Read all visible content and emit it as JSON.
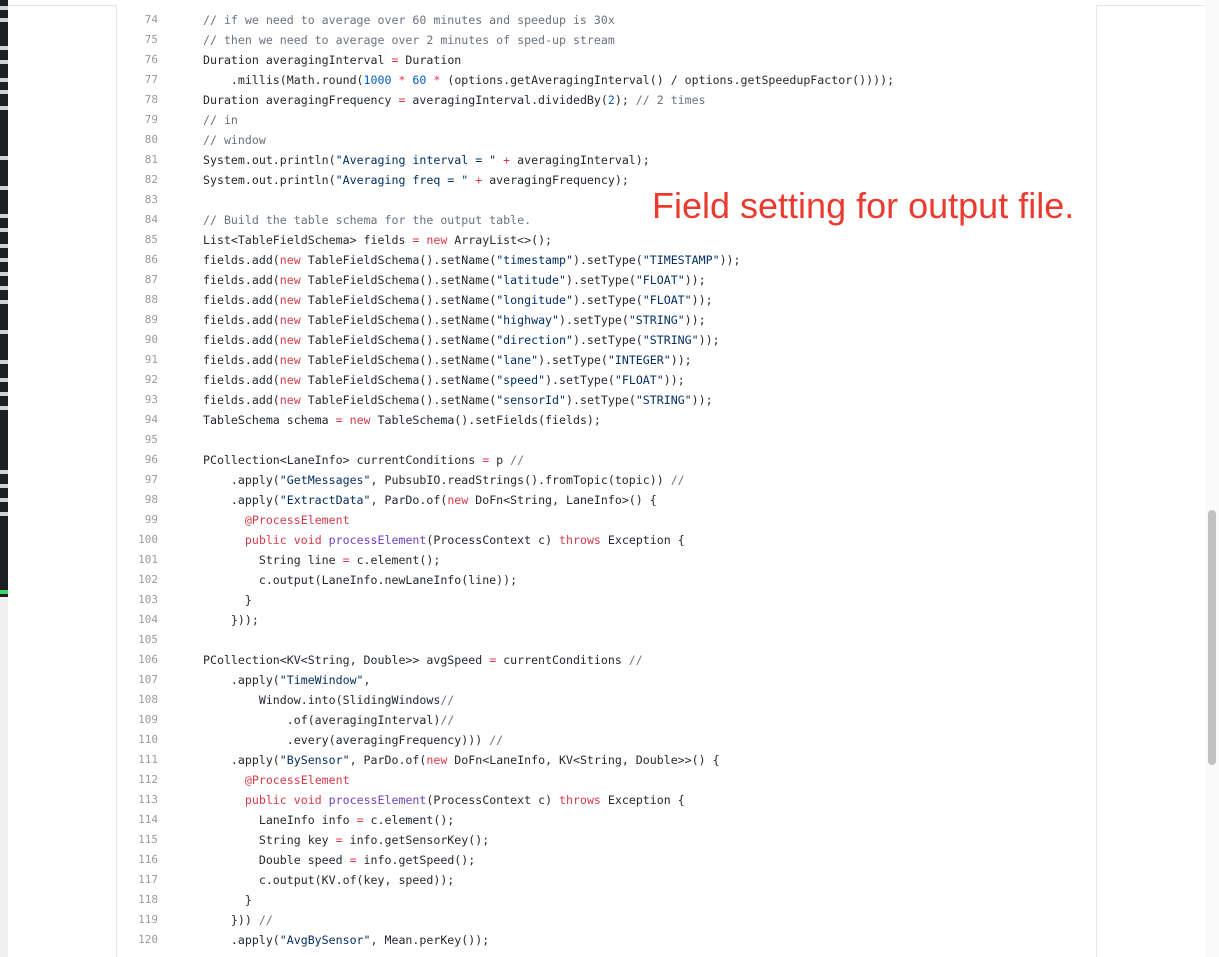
{
  "annotation": {
    "text": "Field setting for output file.",
    "color": "#ea3b30"
  },
  "scrollbar": {
    "position": 0.55
  },
  "code": {
    "lines": [
      {
        "n": "74",
        "t": "// if we need to average over 60 minutes and speedup is 30x"
      },
      {
        "n": "75",
        "t": "// then we need to average over 2 minutes of sped-up stream"
      },
      {
        "n": "76",
        "t": "Duration averagingInterval = Duration"
      },
      {
        "n": "77",
        "t": "    .millis(Math.round(1000 * 60 * (options.getAveragingInterval() / options.getSpeedupFactor())));"
      },
      {
        "n": "78",
        "t": "Duration averagingFrequency = averagingInterval.dividedBy(2); // 2 times"
      },
      {
        "n": "79",
        "t": "// in"
      },
      {
        "n": "80",
        "t": "// window"
      },
      {
        "n": "81",
        "t": "System.out.println(\"Averaging interval = \" + averagingInterval);"
      },
      {
        "n": "82",
        "t": "System.out.println(\"Averaging freq = \" + averagingFrequency);"
      },
      {
        "n": "83",
        "t": ""
      },
      {
        "n": "84",
        "t": "// Build the table schema for the output table."
      },
      {
        "n": "85",
        "t": "List<TableFieldSchema> fields = new ArrayList<>();"
      },
      {
        "n": "86",
        "t": "fields.add(new TableFieldSchema().setName(\"timestamp\").setType(\"TIMESTAMP\"));"
      },
      {
        "n": "87",
        "t": "fields.add(new TableFieldSchema().setName(\"latitude\").setType(\"FLOAT\"));"
      },
      {
        "n": "88",
        "t": "fields.add(new TableFieldSchema().setName(\"longitude\").setType(\"FLOAT\"));"
      },
      {
        "n": "89",
        "t": "fields.add(new TableFieldSchema().setName(\"highway\").setType(\"STRING\"));"
      },
      {
        "n": "90",
        "t": "fields.add(new TableFieldSchema().setName(\"direction\").setType(\"STRING\"));"
      },
      {
        "n": "91",
        "t": "fields.add(new TableFieldSchema().setName(\"lane\").setType(\"INTEGER\"));"
      },
      {
        "n": "92",
        "t": "fields.add(new TableFieldSchema().setName(\"speed\").setType(\"FLOAT\"));"
      },
      {
        "n": "93",
        "t": "fields.add(new TableFieldSchema().setName(\"sensorId\").setType(\"STRING\"));"
      },
      {
        "n": "94",
        "t": "TableSchema schema = new TableSchema().setFields(fields);"
      },
      {
        "n": "95",
        "t": ""
      },
      {
        "n": "96",
        "t": "PCollection<LaneInfo> currentConditions = p //"
      },
      {
        "n": "97",
        "t": "    .apply(\"GetMessages\", PubsubIO.readStrings().fromTopic(topic)) //"
      },
      {
        "n": "98",
        "t": "    .apply(\"ExtractData\", ParDo.of(new DoFn<String, LaneInfo>() {"
      },
      {
        "n": "99",
        "t": "      @ProcessElement"
      },
      {
        "n": "100",
        "t": "      public void processElement(ProcessContext c) throws Exception {"
      },
      {
        "n": "101",
        "t": "        String line = c.element();"
      },
      {
        "n": "102",
        "t": "        c.output(LaneInfo.newLaneInfo(line));"
      },
      {
        "n": "103",
        "t": "      }"
      },
      {
        "n": "104",
        "t": "    }));"
      },
      {
        "n": "105",
        "t": ""
      },
      {
        "n": "106",
        "t": "PCollection<KV<String, Double>> avgSpeed = currentConditions //"
      },
      {
        "n": "107",
        "t": "    .apply(\"TimeWindow\","
      },
      {
        "n": "108",
        "t": "        Window.into(SlidingWindows//"
      },
      {
        "n": "109",
        "t": "            .of(averagingInterval)//"
      },
      {
        "n": "110",
        "t": "            .every(averagingFrequency))) //"
      },
      {
        "n": "111",
        "t": "    .apply(\"BySensor\", ParDo.of(new DoFn<LaneInfo, KV<String, Double>>() {"
      },
      {
        "n": "112",
        "t": "      @ProcessElement"
      },
      {
        "n": "113",
        "t": "      public void processElement(ProcessContext c) throws Exception {"
      },
      {
        "n": "114",
        "t": "        LaneInfo info = c.element();"
      },
      {
        "n": "115",
        "t": "        String key = info.getSensorKey();"
      },
      {
        "n": "116",
        "t": "        Double speed = info.getSpeed();"
      },
      {
        "n": "117",
        "t": "        c.output(KV.of(key, speed));"
      },
      {
        "n": "118",
        "t": "      }"
      },
      {
        "n": "119",
        "t": "    })) //"
      },
      {
        "n": "120",
        "t": "    .apply(\"AvgBySensor\", Mean.perKey());"
      }
    ]
  }
}
